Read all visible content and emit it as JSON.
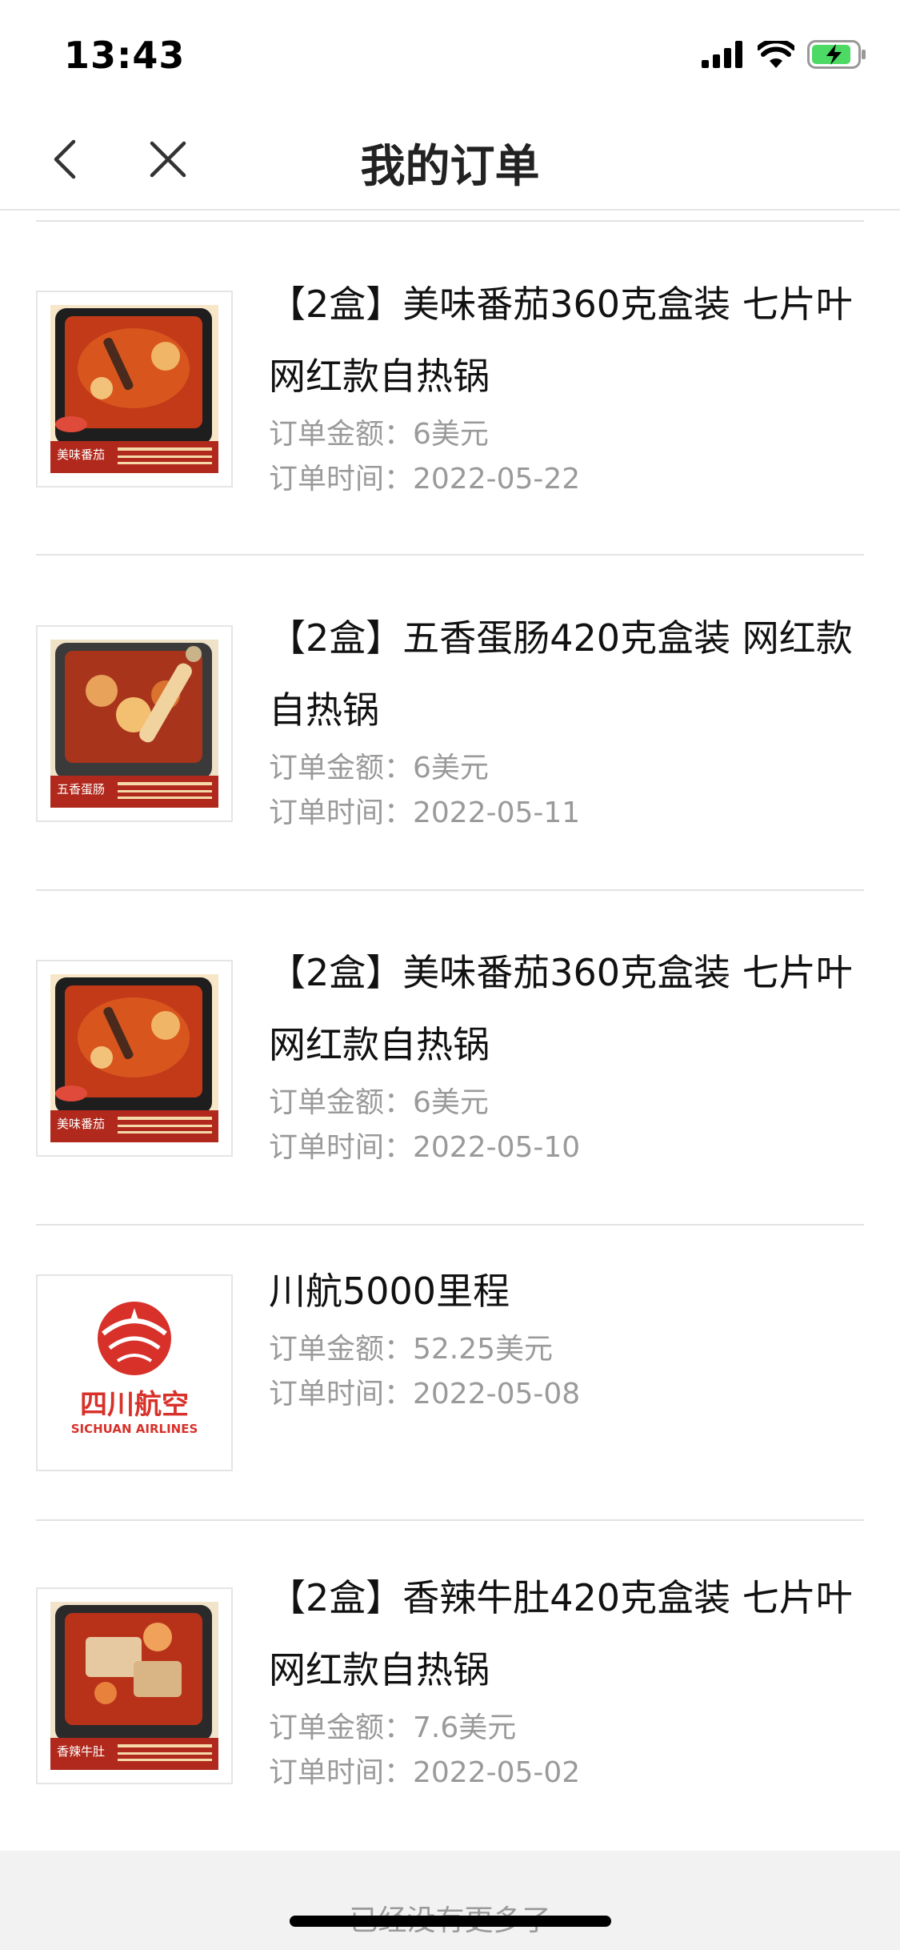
{
  "status_bar": {
    "time": "13:43",
    "battery_color": "#4cd964"
  },
  "nav": {
    "title": "我的订单",
    "back_icon": "chevron-left-icon",
    "close_icon": "close-icon"
  },
  "orders": [
    {
      "title": "【2盒】美味番茄360克盒装 七片叶网红款自热锅",
      "amount": "订单金额：6美元",
      "time": "订单时间：2022-05-22",
      "thumb_label": "美味番茄"
    },
    {
      "title": "【2盒】五香蛋肠420克盒装 网红款自热锅",
      "amount": "订单金额：6美元",
      "time": "订单时间：2022-05-11",
      "thumb_label": "五香蛋肠"
    },
    {
      "title": "【2盒】美味番茄360克盒装 七片叶网红款自热锅",
      "amount": "订单金额：6美元",
      "time": "订单时间：2022-05-10",
      "thumb_label": "美味番茄"
    },
    {
      "title": "川航5000里程",
      "amount": "订单金额：52.25美元",
      "time": "订单时间：2022-05-08",
      "logo_cn": "四川航空",
      "logo_en": "SICHUAN AIRLINES"
    },
    {
      "title": "【2盒】香辣牛肚420克盒装 七片叶网红款自热锅",
      "amount": "订单金额：7.6美元",
      "time": "订单时间：2022-05-02",
      "thumb_label": "香辣牛肚"
    }
  ],
  "footer": {
    "text": "已经没有更多了"
  }
}
